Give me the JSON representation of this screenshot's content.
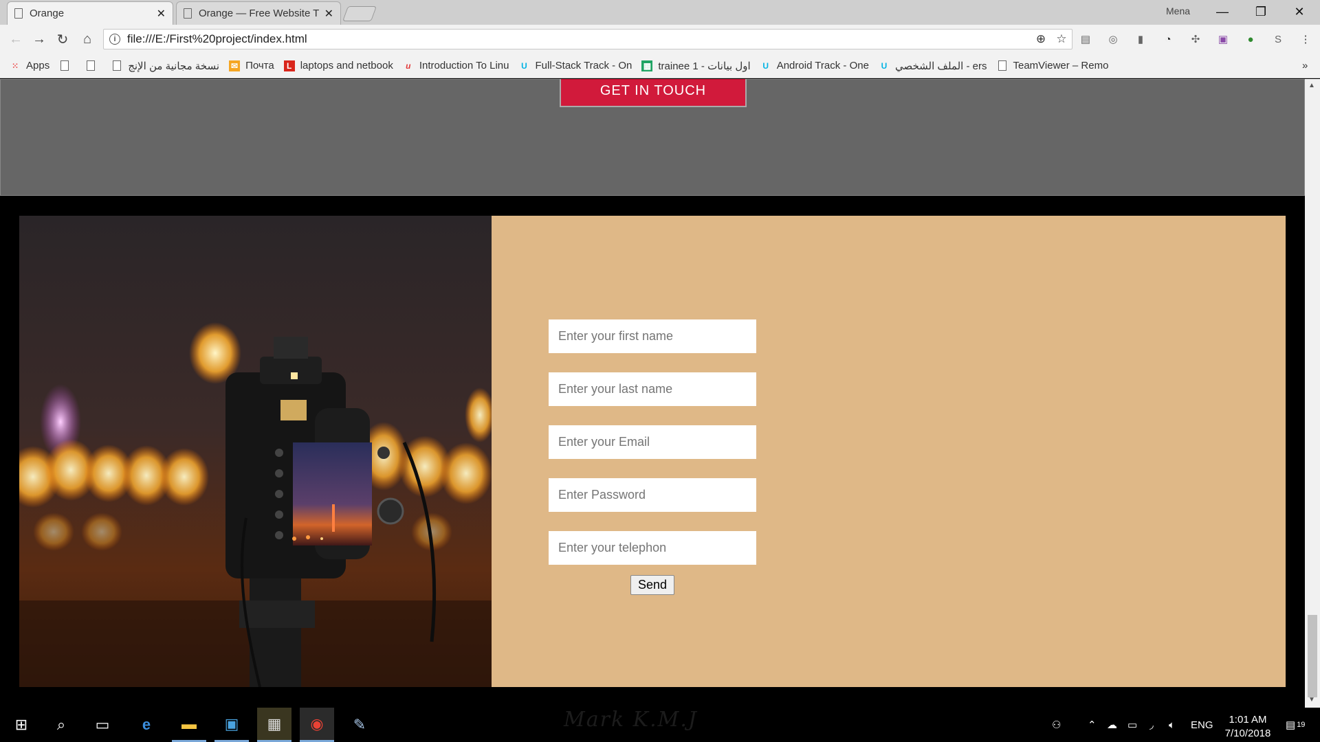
{
  "browser": {
    "tabs": [
      {
        "title": "Orange",
        "active": true
      },
      {
        "title": "Orange — Free Website T",
        "active": false
      }
    ],
    "profile_name": "Mena",
    "url": "file:///E:/First%20project/index.html",
    "bookmarks": [
      {
        "label": "Apps",
        "icon": "apps-grid-icon"
      },
      {
        "label": "",
        "icon": "page-icon"
      },
      {
        "label": "",
        "icon": "page-icon"
      },
      {
        "label": "نسخة مجانية من الإنج",
        "icon": "page-icon"
      },
      {
        "label": "Почта",
        "icon": "mail-icon"
      },
      {
        "label": "laptops and netbook",
        "icon": "l-logo-icon"
      },
      {
        "label": "Introduction To Linu",
        "icon": "udemy-icon"
      },
      {
        "label": "Full-Stack Track - On",
        "icon": "udacity-icon"
      },
      {
        "label": "trainee 1 - اول بيانات",
        "icon": "sheets-icon"
      },
      {
        "label": "Android Track - One",
        "icon": "udacity-icon"
      },
      {
        "label": "الملف الشخصي - ers",
        "icon": "udacity-icon"
      },
      {
        "label": "TeamViewer – Remo",
        "icon": "page-icon"
      }
    ],
    "bookmarks_more": "»"
  },
  "page": {
    "cta_button": "GET IN TOUCH",
    "form": {
      "first_name_placeholder": "Enter your first name",
      "last_name_placeholder": "Enter your last name",
      "email_placeholder": "Enter your Email",
      "password_placeholder": "Enter Password",
      "telephone_placeholder": "Enter your telephon",
      "send_label": "Send"
    },
    "footer_logo": "Mark K.M.J"
  },
  "taskbar": {
    "language": "ENG",
    "time": "1:01 AM",
    "date": "7/10/2018",
    "notifications": "19"
  },
  "colors": {
    "form_panel": "#dfb887",
    "cta": "#d11a3b",
    "grey_section": "#666666"
  }
}
